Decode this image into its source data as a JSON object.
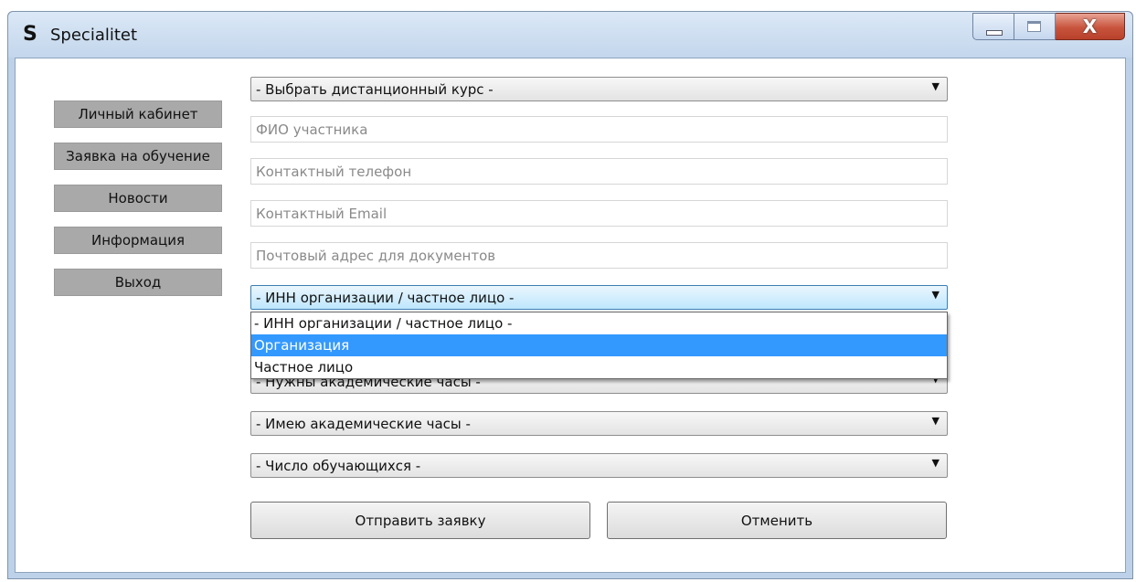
{
  "window": {
    "app_icon": "S",
    "title": "Specialitet",
    "close_glyph": "X"
  },
  "nav": {
    "items": [
      {
        "label": "Личный кабинет"
      },
      {
        "label": "Заявка на обучение"
      },
      {
        "label": "Новости"
      },
      {
        "label": "Информация"
      },
      {
        "label": "Выход"
      }
    ]
  },
  "form": {
    "course_select": "- Выбрать дистанционный курс -",
    "fields": {
      "fio_placeholder": "ФИО участника",
      "phone_placeholder": "Контактный телефон",
      "email_placeholder": "Контактный Email",
      "address_placeholder": "Почтовый адрес для документов"
    },
    "inn_select": "- ИНН организации / частное лицо -",
    "inn_options": [
      "- ИНН организации / частное лицо -",
      "Организация",
      "Частное лицо"
    ],
    "inn_selected_option_index": 1,
    "hours_need_select": "- Нужны академические часы -",
    "hours_have_select": "- Имею академические часы -",
    "students_select": "- Число обучающихся -",
    "submit_label": "Отправить заявку",
    "cancel_label": "Отменить"
  },
  "colors": {
    "highlight": "#3399ff",
    "nav_button": "#a9a9a9",
    "frame": "#bdd2e8"
  }
}
